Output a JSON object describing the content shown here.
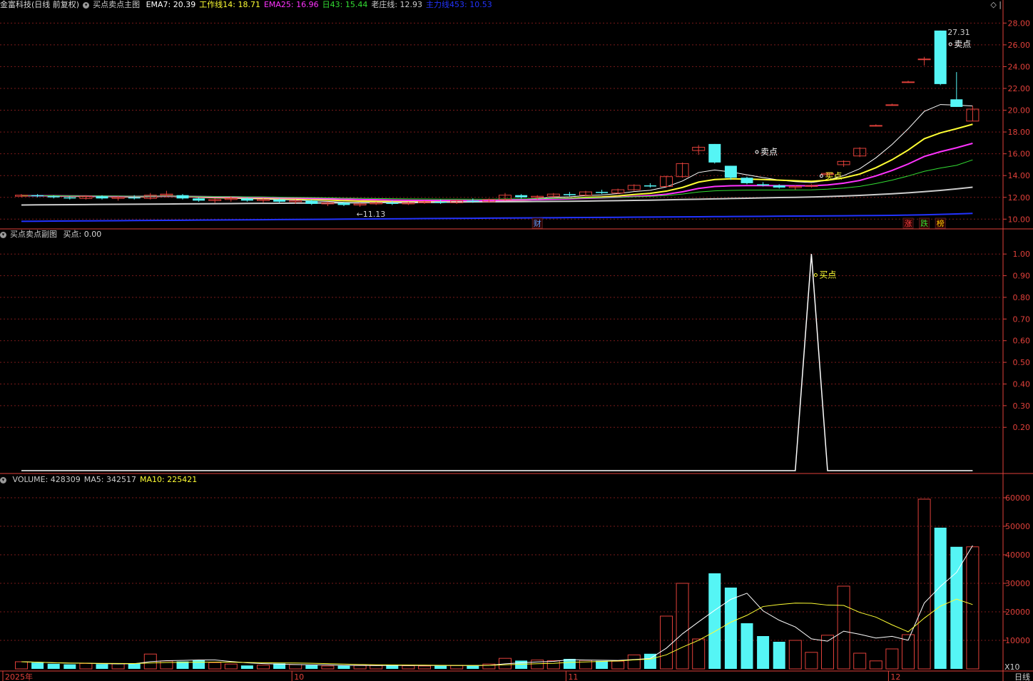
{
  "main_header": {
    "stock": "金富科技(日线 前复权)",
    "indicator": "买点卖点主图",
    "items": [
      {
        "label": "EMA7: 20.39",
        "color": "#ffffff"
      },
      {
        "label": "工作线14: 18.71",
        "color": "#ffff33"
      },
      {
        "label": "EMA25: 16.96",
        "color": "#ff33ff"
      },
      {
        "label": "日43: 15.44",
        "color": "#33dd33"
      },
      {
        "label": "老庄线: 12.93",
        "color": "#cccccc"
      },
      {
        "label": "主力线453: 10.53",
        "color": "#2233ff"
      }
    ]
  },
  "sub_header": {
    "indicator": "买点卖点副图",
    "value": "买点: 0.00"
  },
  "vol_header": {
    "items": [
      {
        "label": "VOLUME: 428309",
        "color": "#cccccc"
      },
      {
        "label": "MA5: 342517",
        "color": "#cccccc"
      },
      {
        "label": "MA10: 225421",
        "color": "#ffff33"
      }
    ]
  },
  "top_icons": "◇ |",
  "chart_data": [
    {
      "type": "candlestick",
      "ylim": [
        9.3,
        29.2
      ],
      "yticks": [
        "10.00",
        "12.00",
        "14.00",
        "16.00",
        "18.00",
        "20.00",
        "22.00",
        "24.00",
        "26.00",
        "28.00"
      ],
      "candles": [
        [
          12.1,
          12.3,
          12.0,
          12.2
        ],
        [
          12.2,
          12.3,
          12.0,
          12.1
        ],
        [
          12.1,
          12.2,
          11.9,
          12.0
        ],
        [
          12.0,
          12.1,
          11.8,
          11.9
        ],
        [
          11.9,
          12.2,
          11.8,
          12.1
        ],
        [
          12.1,
          12.2,
          11.8,
          11.9
        ],
        [
          11.9,
          12.1,
          11.7,
          12.0
        ],
        [
          12.0,
          12.2,
          11.8,
          11.9
        ],
        [
          11.9,
          12.4,
          11.8,
          12.2
        ],
        [
          12.2,
          12.6,
          12.0,
          12.3
        ],
        [
          12.2,
          12.3,
          11.8,
          11.9
        ],
        [
          11.9,
          12.0,
          11.6,
          11.7
        ],
        [
          11.7,
          11.9,
          11.5,
          11.8
        ],
        [
          11.8,
          12.1,
          11.6,
          11.9
        ],
        [
          11.9,
          12.0,
          11.6,
          11.7
        ],
        [
          11.7,
          11.9,
          11.5,
          11.8
        ],
        [
          11.8,
          11.9,
          11.5,
          11.6
        ],
        [
          11.6,
          11.8,
          11.4,
          11.7
        ],
        [
          11.7,
          11.8,
          11.3,
          11.4
        ],
        [
          11.4,
          11.6,
          11.2,
          11.5
        ],
        [
          11.5,
          11.6,
          11.2,
          11.3
        ],
        [
          11.3,
          11.5,
          11.13,
          11.4
        ],
        [
          11.4,
          11.6,
          11.3,
          11.5
        ],
        [
          11.5,
          11.7,
          11.3,
          11.4
        ],
        [
          11.4,
          11.6,
          11.3,
          11.5
        ],
        [
          11.5,
          11.7,
          11.4,
          11.6
        ],
        [
          11.6,
          11.8,
          11.4,
          11.5
        ],
        [
          11.5,
          11.8,
          11.4,
          11.7
        ],
        [
          11.7,
          11.9,
          11.5,
          11.6
        ],
        [
          11.6,
          11.9,
          11.5,
          11.8
        ],
        [
          11.8,
          12.4,
          11.7,
          12.2
        ],
        [
          12.2,
          12.3,
          11.9,
          12.0
        ],
        [
          12.0,
          12.2,
          11.8,
          12.1
        ],
        [
          12.1,
          12.4,
          12.0,
          12.3
        ],
        [
          12.3,
          12.5,
          12.1,
          12.2
        ],
        [
          12.2,
          12.6,
          12.1,
          12.5
        ],
        [
          12.5,
          12.7,
          12.3,
          12.4
        ],
        [
          12.4,
          12.8,
          12.3,
          12.7
        ],
        [
          12.7,
          13.2,
          12.6,
          13.1
        ],
        [
          13.1,
          13.3,
          12.9,
          13.0
        ],
        [
          13.0,
          14.0,
          12.9,
          13.9
        ],
        [
          13.9,
          15.2,
          13.8,
          15.1
        ],
        [
          16.3,
          16.8,
          15.9,
          16.6
        ],
        [
          16.9,
          16.9,
          15.1,
          15.2
        ],
        [
          14.9,
          14.9,
          13.6,
          13.8
        ],
        [
          13.8,
          13.9,
          13.2,
          13.3
        ],
        [
          13.2,
          13.4,
          13.0,
          13.1
        ],
        [
          13.1,
          13.2,
          12.8,
          12.9
        ],
        [
          12.9,
          13.1,
          12.7,
          13.0
        ],
        [
          13.0,
          13.2,
          12.9,
          13.1
        ],
        [
          14.1,
          14.3,
          13.9,
          14.2
        ],
        [
          15.0,
          15.4,
          14.8,
          15.3
        ],
        [
          15.8,
          16.6,
          15.7,
          16.5
        ],
        [
          18.6,
          18.7,
          18.5,
          18.6
        ],
        [
          20.5,
          20.6,
          20.4,
          20.5
        ],
        [
          22.6,
          22.7,
          22.5,
          22.6
        ],
        [
          24.7,
          24.9,
          24.1,
          24.7
        ],
        [
          27.31,
          27.31,
          22.3,
          22.4
        ],
        [
          21.0,
          23.5,
          20.3,
          20.3
        ],
        [
          19.0,
          20.4,
          19.0,
          20.1
        ]
      ],
      "series": [
        {
          "name": "EMA7",
          "color": "#ffffff",
          "values": [
            12.15,
            12.16,
            12.13,
            12.08,
            12.09,
            12.05,
            12.04,
            12.01,
            12.06,
            12.12,
            12.07,
            11.98,
            11.94,
            11.93,
            11.87,
            11.85,
            11.79,
            11.76,
            11.67,
            11.63,
            11.55,
            11.51,
            11.51,
            11.48,
            11.48,
            11.51,
            11.51,
            11.56,
            11.57,
            11.63,
            11.77,
            11.83,
            11.9,
            12.0,
            12.05,
            12.16,
            12.22,
            12.34,
            12.53,
            12.65,
            12.96,
            13.5,
            14.28,
            14.51,
            14.33,
            14.07,
            13.82,
            13.59,
            13.44,
            13.36,
            13.57,
            14.0,
            14.63,
            15.63,
            16.85,
            18.29,
            19.89,
            20.52,
            20.47,
            20.39
          ]
        },
        {
          "name": "工作线14",
          "color": "#ffff33",
          "values": [
            12.15,
            12.15,
            12.14,
            12.11,
            12.11,
            12.09,
            12.08,
            12.06,
            12.08,
            12.11,
            12.08,
            12.03,
            12.0,
            11.99,
            11.95,
            11.93,
            11.89,
            11.86,
            11.8,
            11.76,
            11.7,
            11.66,
            11.64,
            11.61,
            11.6,
            11.6,
            11.59,
            11.6,
            11.61,
            11.64,
            11.71,
            11.75,
            11.8,
            11.87,
            11.91,
            11.99,
            12.04,
            12.13,
            12.26,
            12.37,
            12.57,
            12.91,
            13.4,
            13.64,
            13.7,
            13.68,
            13.64,
            13.58,
            13.52,
            13.47,
            13.57,
            13.79,
            14.14,
            14.72,
            15.45,
            16.34,
            17.38,
            17.92,
            18.3,
            18.71
          ]
        },
        {
          "name": "EMA25",
          "color": "#ff33ff",
          "values": [
            12.15,
            12.15,
            12.14,
            12.13,
            12.12,
            12.11,
            12.1,
            12.09,
            12.1,
            12.11,
            12.1,
            12.07,
            12.05,
            12.04,
            12.01,
            11.99,
            11.96,
            11.94,
            11.9,
            11.87,
            11.83,
            11.8,
            11.78,
            11.75,
            11.73,
            11.72,
            11.71,
            11.71,
            11.7,
            11.71,
            11.75,
            11.77,
            11.79,
            11.83,
            11.86,
            11.91,
            11.95,
            12.01,
            12.09,
            12.16,
            12.29,
            12.51,
            12.82,
            13.0,
            13.06,
            13.08,
            13.08,
            13.07,
            13.06,
            13.06,
            13.14,
            13.3,
            13.55,
            13.97,
            14.47,
            15.06,
            15.75,
            16.19,
            16.55,
            16.96
          ]
        },
        {
          "name": "日43",
          "color": "#33dd33",
          "values": [
            12.15,
            12.15,
            12.15,
            12.14,
            12.13,
            12.12,
            12.12,
            12.11,
            12.11,
            12.12,
            12.11,
            12.09,
            12.08,
            12.07,
            12.05,
            12.04,
            12.02,
            12.0,
            11.98,
            11.96,
            11.93,
            11.91,
            11.89,
            11.88,
            11.86,
            11.85,
            11.84,
            11.84,
            11.83,
            11.83,
            11.85,
            11.86,
            11.87,
            11.89,
            11.91,
            11.94,
            11.96,
            12.0,
            12.05,
            12.09,
            12.17,
            12.3,
            12.49,
            12.6,
            12.64,
            12.66,
            12.67,
            12.67,
            12.68,
            12.69,
            12.75,
            12.85,
            13.01,
            13.27,
            13.58,
            13.96,
            14.39,
            14.69,
            14.94,
            15.44
          ]
        },
        {
          "name": "老庄线",
          "color": "#cccccc",
          "values": [
            11.3,
            11.31,
            11.32,
            11.33,
            11.34,
            11.35,
            11.36,
            11.37,
            11.38,
            11.39,
            11.4,
            11.41,
            11.42,
            11.43,
            11.44,
            11.45,
            11.46,
            11.47,
            11.48,
            11.49,
            11.5,
            11.51,
            11.52,
            11.53,
            11.54,
            11.55,
            11.56,
            11.57,
            11.58,
            11.59,
            11.6,
            11.61,
            11.62,
            11.63,
            11.64,
            11.66,
            11.68,
            11.7,
            11.72,
            11.74,
            11.77,
            11.8,
            11.83,
            11.86,
            11.89,
            11.92,
            11.95,
            11.98,
            12.0,
            12.03,
            12.07,
            12.12,
            12.18,
            12.25,
            12.33,
            12.42,
            12.52,
            12.64,
            12.78,
            12.93
          ]
        },
        {
          "name": "主力线453",
          "color": "#2233ff",
          "values": [
            9.8,
            9.81,
            9.82,
            9.83,
            9.84,
            9.85,
            9.86,
            9.87,
            9.88,
            9.89,
            9.9,
            9.91,
            9.92,
            9.93,
            9.94,
            9.95,
            9.96,
            9.97,
            9.98,
            9.99,
            10.0,
            10.01,
            10.02,
            10.03,
            10.04,
            10.05,
            10.06,
            10.07,
            10.08,
            10.09,
            10.1,
            10.11,
            10.12,
            10.13,
            10.14,
            10.15,
            10.16,
            10.17,
            10.18,
            10.19,
            10.2,
            10.21,
            10.22,
            10.23,
            10.24,
            10.25,
            10.26,
            10.27,
            10.28,
            10.29,
            10.3,
            10.31,
            10.32,
            10.33,
            10.35,
            10.37,
            10.4,
            10.44,
            10.48,
            10.53
          ]
        }
      ],
      "annotations": [
        {
          "index": 57,
          "price": 27.31,
          "text": "27.31"
        },
        {
          "index": 21,
          "price": 11.13,
          "text": "←11.13"
        }
      ],
      "signals": [
        {
          "index": 45,
          "price": 15.9,
          "text": "卖点"
        },
        {
          "index": 57,
          "price": 25.8,
          "text": "卖点"
        },
        {
          "index": 49,
          "price": 13.7,
          "text": "买点"
        }
      ],
      "event_tags": [
        {
          "index": 32,
          "text": "财",
          "color": "#5aa0ff"
        },
        {
          "index": 55,
          "text": "涨",
          "color": "#ff4444"
        },
        {
          "index": 56,
          "text": "跌",
          "color": "#33dd33"
        },
        {
          "index": 57,
          "text": "榜",
          "color": "#ffcc00"
        }
      ]
    },
    {
      "type": "line",
      "name": "买点",
      "ylim": [
        0.0,
        1.06
      ],
      "yticks": [
        "1.00",
        "0.90",
        "0.80",
        "0.70",
        "0.60",
        "0.50",
        "0.40",
        "0.30",
        "0.20"
      ],
      "values": [
        0,
        0,
        0,
        0,
        0,
        0,
        0,
        0,
        0,
        0,
        0,
        0,
        0,
        0,
        0,
        0,
        0,
        0,
        0,
        0,
        0,
        0,
        0,
        0,
        0,
        0,
        0,
        0,
        0,
        0,
        0,
        0,
        0,
        0,
        0,
        0,
        0,
        0,
        0,
        0,
        0,
        0,
        0,
        0,
        0,
        0,
        0,
        0,
        0,
        1,
        0,
        0,
        0,
        0,
        0,
        0,
        0,
        0,
        0,
        0
      ],
      "signal": {
        "index": 49,
        "value": 0.9,
        "text": "买点"
      }
    },
    {
      "type": "bar",
      "unit_label": "X10",
      "ylim": [
        0,
        64000
      ],
      "yticks": [
        "60000",
        "50000",
        "40000",
        "30000",
        "20000",
        "10000"
      ],
      "values": [
        2500,
        2200,
        1800,
        1600,
        1900,
        1700,
        1800,
        2000,
        5200,
        2800,
        2600,
        3000,
        2200,
        1700,
        1200,
        1300,
        1900,
        1500,
        1300,
        1000,
        1100,
        1200,
        1200,
        1400,
        1100,
        1000,
        1100,
        1200,
        1100,
        1700,
        3700,
        2900,
        3100,
        2900,
        3500,
        3000,
        2800,
        2700,
        4900,
        5300,
        18500,
        30000,
        10500,
        33500,
        28500,
        16000,
        11500,
        9500,
        10000,
        5800,
        11800,
        29000,
        5500,
        2800,
        7000,
        12000,
        59500,
        49500,
        42800,
        42800
      ],
      "ma5": [
        2500,
        2350,
        2170,
        2025,
        1990,
        1840,
        1760,
        1800,
        2520,
        2860,
        2980,
        3120,
        3120,
        2580,
        2140,
        1840,
        1660,
        1520,
        1440,
        1400,
        1220,
        1220,
        1160,
        1240,
        1200,
        1180,
        1200,
        1200,
        1180,
        1220,
        1780,
        2120,
        2440,
        2620,
        3220,
        3080,
        3040,
        2960,
        3280,
        3660,
        7240,
        12300,
        16480,
        20540,
        24380,
        26520,
        20340,
        17060,
        14700,
        10520,
        9720,
        13220,
        12120,
        10820,
        11400,
        10040,
        23080,
        28920,
        33820,
        43260
      ],
      "ma5_values_note": "",
      "ma10": [
        2500,
        2350,
        2170,
        2025,
        1990,
        1940,
        1900,
        1890,
        2050,
        2240,
        2270,
        2330,
        2370,
        2340,
        2250,
        2160,
        2100,
        2050,
        1960,
        1830,
        1680,
        1540,
        1440,
        1370,
        1350,
        1320,
        1240,
        1210,
        1190,
        1240,
        1450,
        1620,
        1820,
        1940,
        2310,
        2430,
        2610,
        2780,
        3160,
        3440,
        4920,
        7620,
        10010,
        13090,
        16380,
        18780,
        21860,
        22560,
        23070,
        23010,
        22360,
        22240,
        19790,
        18140,
        15440,
        13000,
        17800,
        22000,
        24450,
        22542
      ]
    }
  ],
  "x_axis": {
    "labels": [
      {
        "index": 0,
        "text": "2025年"
      },
      {
        "index": 17,
        "text": "10"
      },
      {
        "index": 34,
        "text": "11"
      },
      {
        "index": 54,
        "text": "12"
      }
    ],
    "right_label": "日线"
  }
}
